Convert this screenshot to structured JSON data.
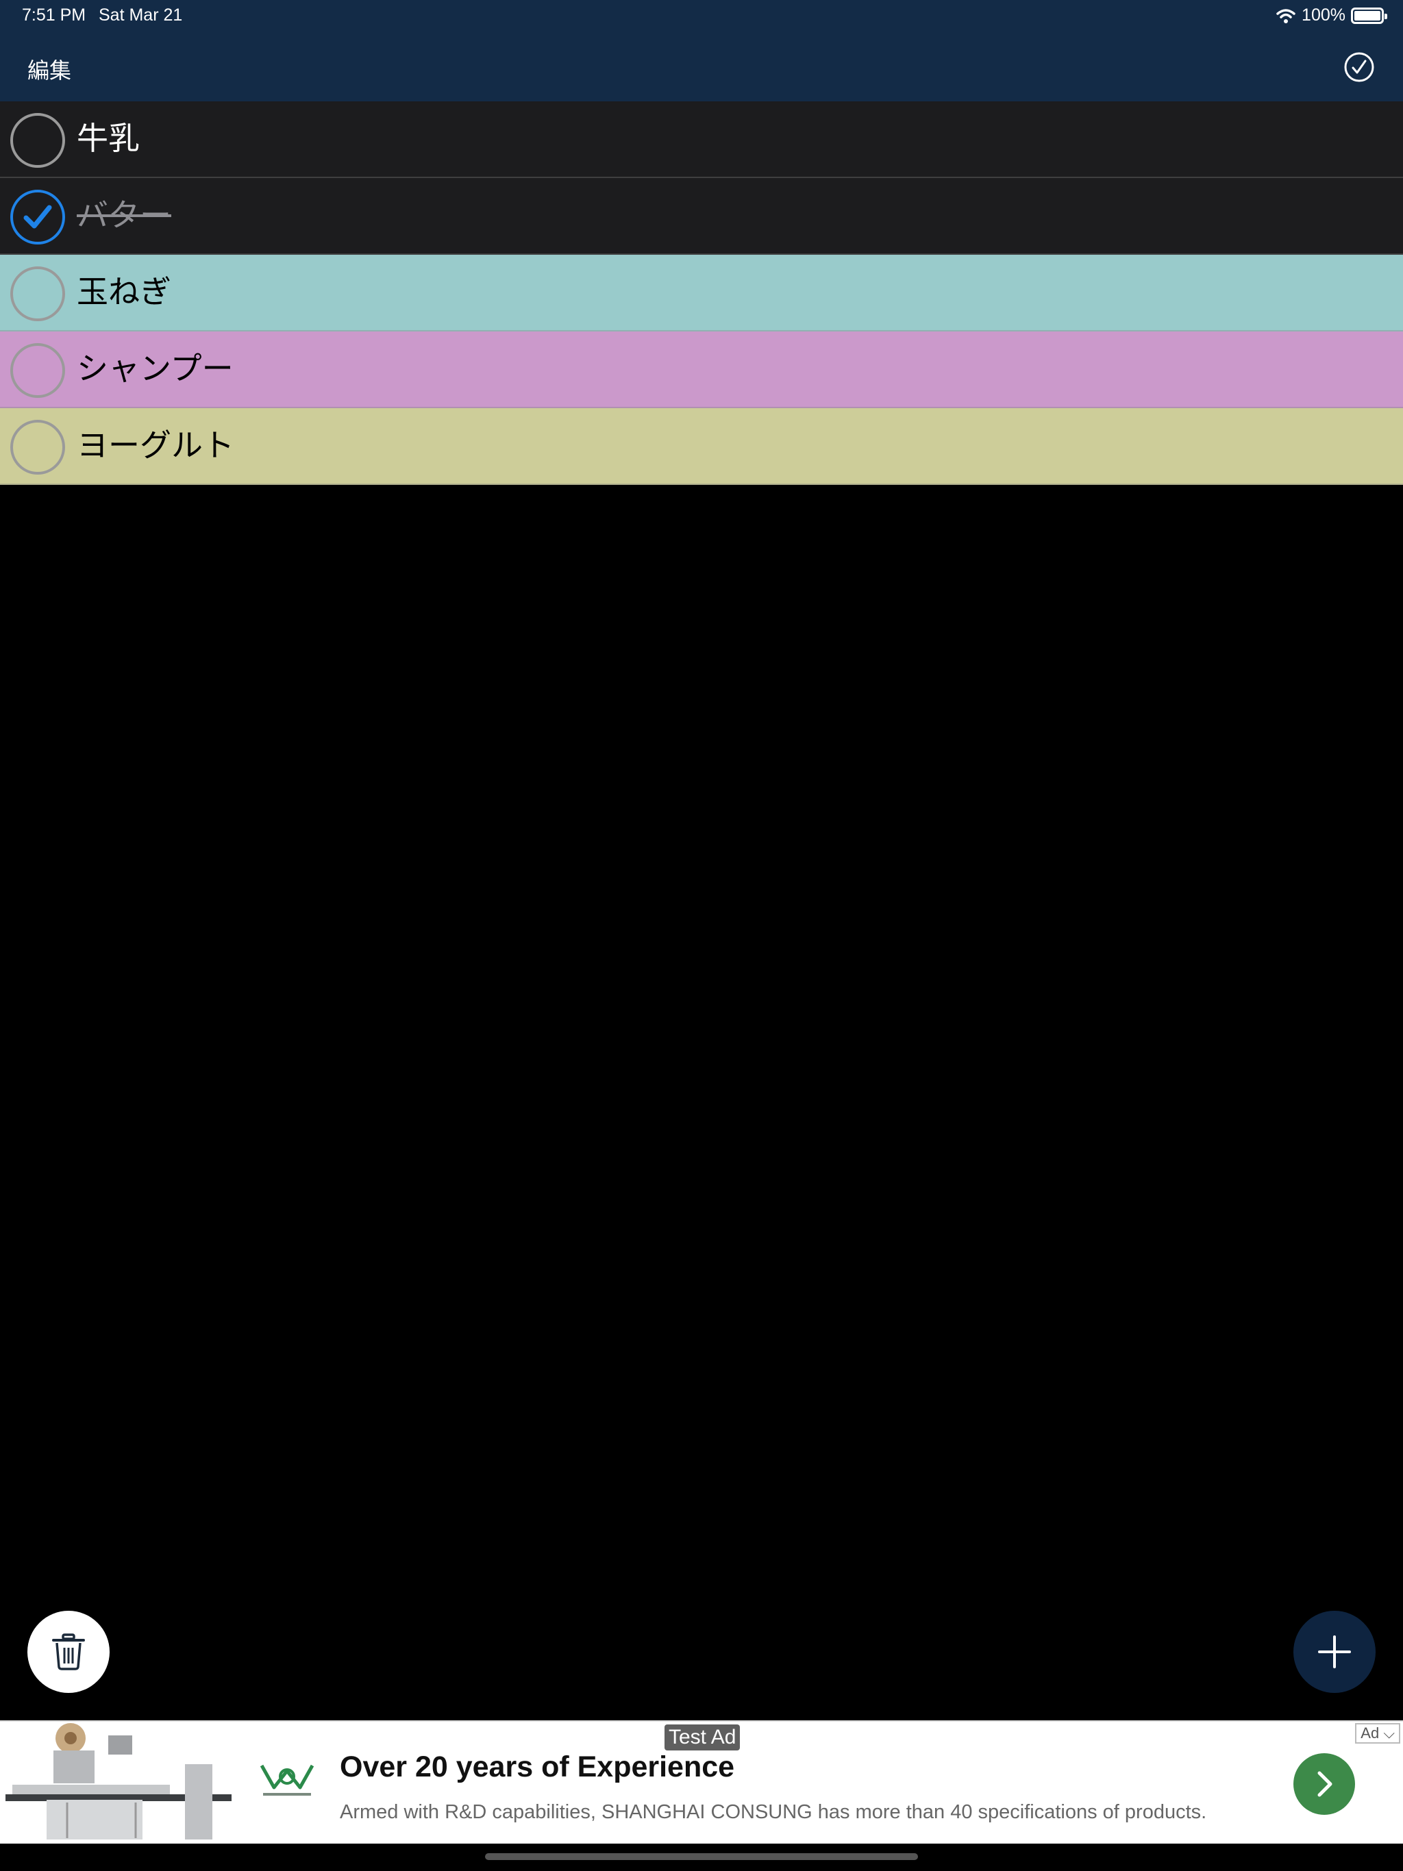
{
  "status_bar": {
    "time": "7:51 PM",
    "date": "Sat Mar 21",
    "battery": "100%",
    "icons": [
      "wifi-icon",
      "battery-icon"
    ]
  },
  "nav": {
    "edit_label": "編集",
    "done_icon": "checkmark-circle-icon"
  },
  "items": [
    {
      "label": "牛乳",
      "checked": false,
      "bg": "#1c1c1e",
      "text_color": "#ffffff"
    },
    {
      "label": "バター",
      "checked": true,
      "bg": "#1c1c1e",
      "text_color": "#8e8e93"
    },
    {
      "label": "玉ねぎ",
      "checked": false,
      "bg": "#99cbcb",
      "text_color": "#000000"
    },
    {
      "label": "シャンプー",
      "checked": false,
      "bg": "#cb99cb",
      "text_color": "#000000"
    },
    {
      "label": "ヨーグルト",
      "checked": false,
      "bg": "#cdcd99",
      "text_color": "#000000"
    }
  ],
  "buttons": {
    "delete_icon": "trash-icon",
    "add_icon": "plus-icon"
  },
  "ad": {
    "tag": "Test Ad",
    "choices": "Ad",
    "headline": "Over 20 years of Experience",
    "body": "Armed with R&D capabilities, SHANGHAI CONSUNG has more than 40 specifications of products.",
    "cta_icon": "chevron-right-icon",
    "cta_color": "#3d8a49"
  },
  "colors": {
    "nav_bg": "#132b47",
    "checked_blue": "#1f83e8",
    "add_button_bg": "#0e2440"
  }
}
